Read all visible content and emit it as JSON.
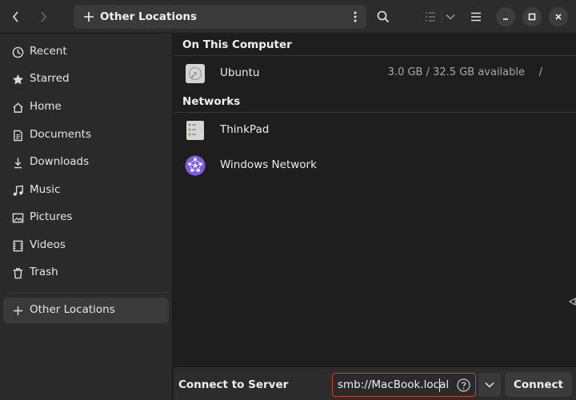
{
  "header": {
    "path_label": "Other Locations"
  },
  "sidebar": {
    "items": [
      {
        "label": "Recent",
        "icon": "clock-icon"
      },
      {
        "label": "Starred",
        "icon": "star-icon"
      },
      {
        "label": "Home",
        "icon": "home-icon"
      },
      {
        "label": "Documents",
        "icon": "document-icon"
      },
      {
        "label": "Downloads",
        "icon": "download-icon"
      },
      {
        "label": "Music",
        "icon": "music-icon"
      },
      {
        "label": "Pictures",
        "icon": "picture-icon"
      },
      {
        "label": "Videos",
        "icon": "video-icon"
      },
      {
        "label": "Trash",
        "icon": "trash-icon"
      }
    ],
    "other_locations": {
      "label": "Other Locations",
      "icon": "plus-icon"
    }
  },
  "main": {
    "on_this_computer": {
      "heading": "On This Computer",
      "items": [
        {
          "name": "Ubuntu",
          "info": "3.0 GB / 32.5 GB available",
          "mount": "/",
          "icon": "drive-icon"
        }
      ]
    },
    "networks": {
      "heading": "Networks",
      "items": [
        {
          "name": "ThinkPad",
          "icon": "server-icon"
        },
        {
          "name": "Windows Network",
          "icon": "network-icon"
        }
      ]
    }
  },
  "bottom": {
    "label": "Connect to Server",
    "server_value": "smb://MacBook.local",
    "connect_label": "Connect"
  },
  "colors": {
    "accent_border": "#c7462f",
    "network_icon": "#7b5fd6"
  }
}
